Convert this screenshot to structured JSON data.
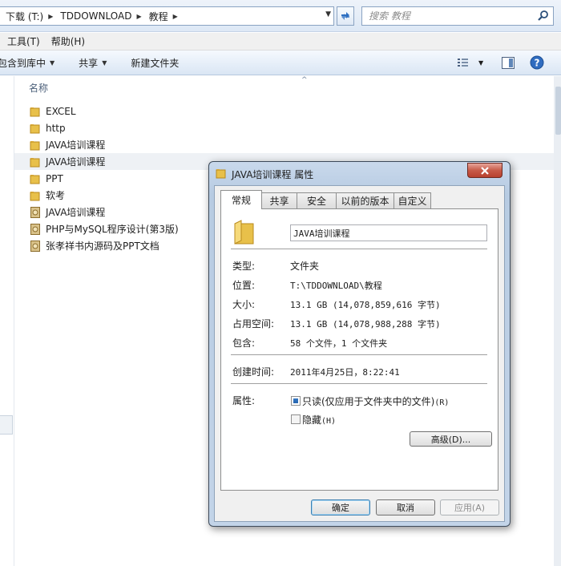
{
  "address": {
    "crumbs": [
      "下载 (T:)",
      "TDDOWNLOAD",
      "教程"
    ]
  },
  "search": {
    "placeholder": "搜索 教程"
  },
  "menu": {
    "tools": "工具(T)",
    "help": "帮助(H)"
  },
  "command_bar": {
    "include": "包含到库中",
    "share": "共享",
    "new_folder": "新建文件夹"
  },
  "file_list": {
    "column_name": "名称",
    "items": [
      {
        "name": "EXCEL",
        "type": "folder"
      },
      {
        "name": "http",
        "type": "folder"
      },
      {
        "name": "JAVA培训课程",
        "type": "folder"
      },
      {
        "name": "JAVA培训课程",
        "type": "folder",
        "selected": true
      },
      {
        "name": "PPT",
        "type": "folder"
      },
      {
        "name": "软考",
        "type": "folder"
      },
      {
        "name": "JAVA培训课程",
        "type": "archive"
      },
      {
        "name": "PHP与MySQL程序设计(第3版)",
        "type": "archive"
      },
      {
        "name": "张孝祥书内源码及PPT文档",
        "type": "archive"
      }
    ]
  },
  "dialog": {
    "title": "JAVA培训课程 属性",
    "tabs": [
      "常规",
      "共享",
      "安全",
      "以前的版本",
      "自定义"
    ],
    "name_value": "JAVA培训课程",
    "props": {
      "type_label": "类型:",
      "type_value": "文件夹",
      "location_label": "位置:",
      "location_value": "T:\\TDDOWNLOAD\\教程",
      "size_label": "大小:",
      "size_value": "13.1 GB (14,078,859,616 字节)",
      "disk_label": "占用空间:",
      "disk_value": "13.1 GB (14,078,988,288 字节)",
      "contains_label": "包含:",
      "contains_value": "58 个文件，1 个文件夹",
      "created_label": "创建时间:",
      "created_value": "2011年4月25日，8:22:41",
      "attr_label": "属性:"
    },
    "readonly_label": "只读(仅应用于文件夹中的文件)",
    "readonly_hotkey": "(R)",
    "hidden_label": "隐藏",
    "hidden_hotkey": "(H)",
    "advanced_button": "高级(D)...",
    "ok_button": "确定",
    "cancel_button": "取消",
    "apply_button": "应用(A)"
  },
  "icons": {
    "folder": "folder-icon",
    "archive": "archive-icon",
    "search": "search-icon",
    "refresh": "refresh-icon",
    "help": "help-icon",
    "close": "close-icon"
  },
  "colors": {
    "folder": "#e8c04a",
    "selection": "#eef1f5",
    "close_button": "#c75a48"
  }
}
